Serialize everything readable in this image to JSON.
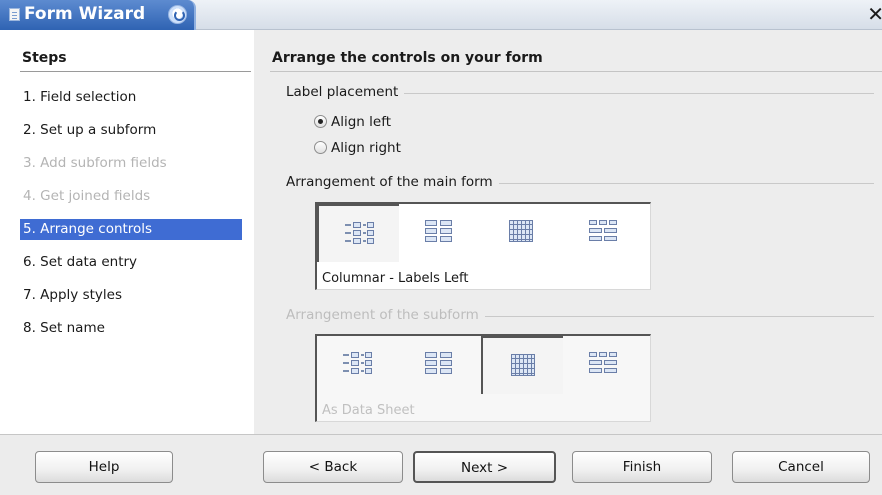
{
  "window": {
    "title": "Form Wizard"
  },
  "steps": {
    "header": "Steps",
    "items": [
      {
        "label": "1. Field selection",
        "state": "normal"
      },
      {
        "label": "2. Set up a subform",
        "state": "normal"
      },
      {
        "label": "3. Add subform fields",
        "state": "disabled"
      },
      {
        "label": "4. Get joined fields",
        "state": "disabled"
      },
      {
        "label": "5. Arrange controls",
        "state": "active"
      },
      {
        "label": "6. Set data entry",
        "state": "normal"
      },
      {
        "label": "7. Apply styles",
        "state": "normal"
      },
      {
        "label": "8. Set name",
        "state": "normal"
      }
    ]
  },
  "main": {
    "title": "Arrange the controls on your form",
    "label_placement": {
      "label": "Label placement",
      "align_left": "Align left",
      "align_right": "Align right",
      "selected": "align_left"
    },
    "main_form": {
      "label": "Arrangement of the main form",
      "selected_name": "Columnar - Labels Left",
      "selected_index": 0
    },
    "subform": {
      "label": "Arrangement of the subform",
      "selected_name": "As Data Sheet",
      "selected_index": 2
    },
    "arrangement_options": [
      "columnar-labels-left-icon",
      "columnar-labels-on-top-icon",
      "data-sheet-icon",
      "in-blocks-labels-above-icon"
    ]
  },
  "buttons": {
    "help": "Help",
    "back": "< Back",
    "next": "Next >",
    "finish": "Finish",
    "cancel": "Cancel"
  },
  "colors": {
    "accent": "#3f6cd3",
    "titlebar": "#2f63b3",
    "disabled": "#b4b4b4"
  }
}
